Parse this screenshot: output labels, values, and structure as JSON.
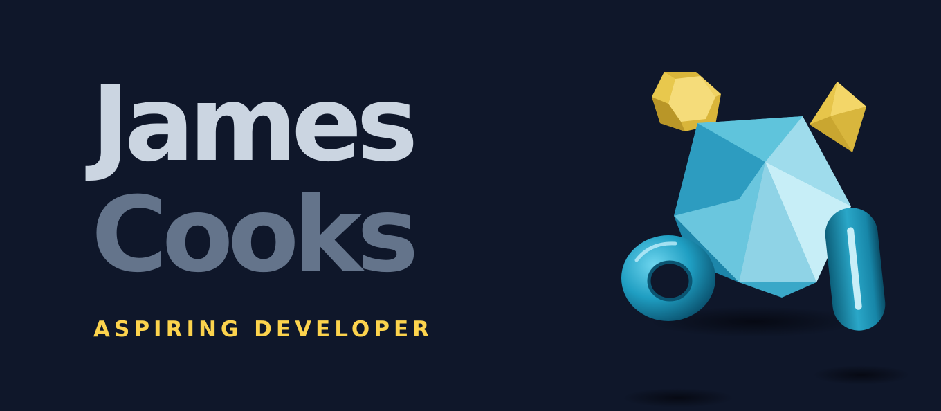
{
  "hero": {
    "first_name": "James",
    "last_name": "Cooks",
    "tagline": "ASPIRING DEVELOPER"
  },
  "colors": {
    "background": "#0f172a",
    "first_name": "#cbd5e1",
    "last_name": "#64748b",
    "tagline": "#fcd34d",
    "gem_blue": "#5bc2da",
    "gem_gold": "#e9c94a"
  },
  "illustration": {
    "shapes": [
      "icosahedron",
      "gold-dodecahedron",
      "gold-octahedron",
      "torus",
      "capsule"
    ]
  }
}
